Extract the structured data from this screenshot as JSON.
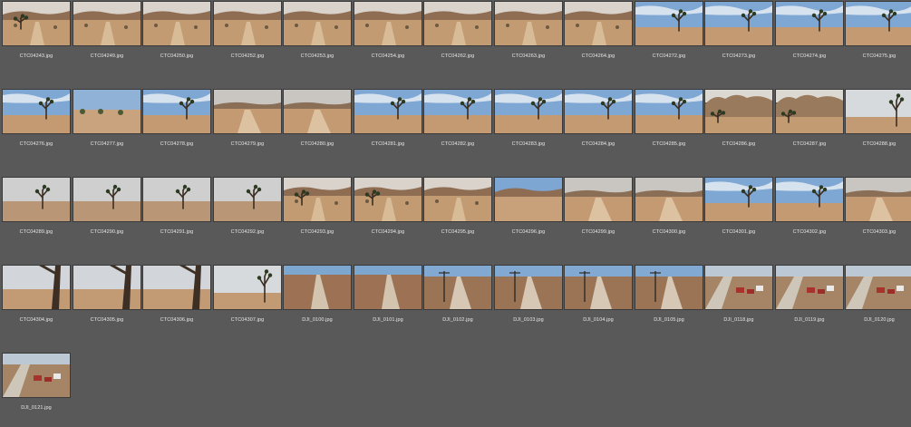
{
  "files": [
    {
      "name": "CTC04243.jpg",
      "scene": "hill-tree"
    },
    {
      "name": "CTC04249.jpg",
      "scene": "hill"
    },
    {
      "name": "CTC04250.jpg",
      "scene": "hill"
    },
    {
      "name": "CTC04252.jpg",
      "scene": "hill"
    },
    {
      "name": "CTC04253.jpg",
      "scene": "hill"
    },
    {
      "name": "CTC04254.jpg",
      "scene": "hill"
    },
    {
      "name": "CTC04262.jpg",
      "scene": "hill"
    },
    {
      "name": "CTC04263.jpg",
      "scene": "hill"
    },
    {
      "name": "CTC04264.jpg",
      "scene": "hill"
    },
    {
      "name": "CTC04272.jpg",
      "scene": "joshua-sky"
    },
    {
      "name": "CTC04273.jpg",
      "scene": "joshua-sky"
    },
    {
      "name": "CTC04274.jpg",
      "scene": "joshua-sky"
    },
    {
      "name": "CTC04275.jpg",
      "scene": "joshua-sky"
    },
    {
      "name": "CTC04276.jpg",
      "scene": "joshua-sky"
    },
    {
      "name": "CTC04277.jpg",
      "scene": "desert-brush"
    },
    {
      "name": "CTC04278.jpg",
      "scene": "joshua-sky"
    },
    {
      "name": "CTC04279.jpg",
      "scene": "hill-road"
    },
    {
      "name": "CTC04280.jpg",
      "scene": "hill-road"
    },
    {
      "name": "CTC04281.jpg",
      "scene": "joshua-sky"
    },
    {
      "name": "CTC04282.jpg",
      "scene": "joshua-sky"
    },
    {
      "name": "CTC04283.jpg",
      "scene": "joshua-sky"
    },
    {
      "name": "CTC04284.jpg",
      "scene": "joshua-sky"
    },
    {
      "name": "CTC04285.jpg",
      "scene": "joshua-sky"
    },
    {
      "name": "CTC04286.jpg",
      "scene": "rocks"
    },
    {
      "name": "CTC04287.jpg",
      "scene": "rocks"
    },
    {
      "name": "CTC04288.jpg",
      "scene": "joshua-close"
    },
    {
      "name": "CTC04289.jpg",
      "scene": "joshua-grey"
    },
    {
      "name": "CTC04290.jpg",
      "scene": "joshua-grey"
    },
    {
      "name": "CTC04291.jpg",
      "scene": "joshua-grey"
    },
    {
      "name": "CTC04292.jpg",
      "scene": "joshua-grey"
    },
    {
      "name": "CTC04293.jpg",
      "scene": "hill-tree"
    },
    {
      "name": "CTC04294.jpg",
      "scene": "hill-tree"
    },
    {
      "name": "CTC04295.jpg",
      "scene": "hill"
    },
    {
      "name": "CTC04296.jpg",
      "scene": "hill-blue"
    },
    {
      "name": "CTC04299.jpg",
      "scene": "hill-road"
    },
    {
      "name": "CTC04300.jpg",
      "scene": "hill-road"
    },
    {
      "name": "CTC04301.jpg",
      "scene": "joshua-sky"
    },
    {
      "name": "CTC04302.jpg",
      "scene": "joshua-sky"
    },
    {
      "name": "CTC04303.jpg",
      "scene": "hill-road"
    },
    {
      "name": "CTC04304.jpg",
      "scene": "trunk"
    },
    {
      "name": "CTC04305.jpg",
      "scene": "trunk"
    },
    {
      "name": "CTC04306.jpg",
      "scene": "trunk"
    },
    {
      "name": "CTC04307.jpg",
      "scene": "joshua-close"
    },
    {
      "name": "DJI_0100.jpg",
      "scene": "drone-road"
    },
    {
      "name": "DJI_0101.jpg",
      "scene": "drone-road"
    },
    {
      "name": "DJI_0102.jpg",
      "scene": "drone-pole"
    },
    {
      "name": "DJI_0103.jpg",
      "scene": "drone-pole"
    },
    {
      "name": "DJI_0104.jpg",
      "scene": "drone-pole"
    },
    {
      "name": "DJI_0105.jpg",
      "scene": "drone-pole"
    },
    {
      "name": "DJI_0118.jpg",
      "scene": "drone-houses"
    },
    {
      "name": "DJI_0119.jpg",
      "scene": "drone-houses"
    },
    {
      "name": "DJI_0120.jpg",
      "scene": "drone-houses"
    },
    {
      "name": "DJI_0121.jpg",
      "scene": "drone-houses"
    }
  ],
  "colors": {
    "background": "#595959",
    "caption": "#e8e8e8",
    "sand": "#c49a72",
    "sky": "#8fb2d6"
  }
}
